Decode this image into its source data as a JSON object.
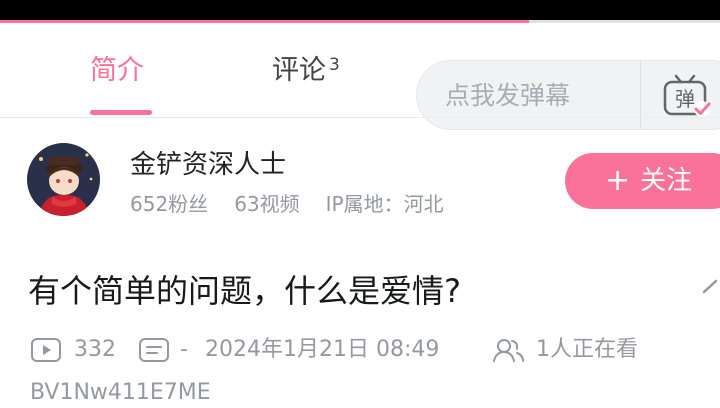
{
  "progress": {
    "fraction": 0.735
  },
  "tabs": {
    "intro_label": "简介",
    "comments_label": "评论",
    "comments_count": "3"
  },
  "danmaku": {
    "placeholder": "点我发弹幕",
    "toggle_label": "弹"
  },
  "uploader": {
    "name": "金铲资深人士",
    "followers": "652粉丝",
    "videos": "63视频",
    "ip_location": "IP属地：河北"
  },
  "follow_button": {
    "plus": "+",
    "label": "关注"
  },
  "video": {
    "title": "有个简单的问题，什么是爱情?",
    "plays": "332",
    "danmaku_count": "-",
    "date": "2024年1月21日 08:49",
    "watching": "1人正在看",
    "bvid": "BV1Nw411E7ME"
  },
  "colors": {
    "accent": "#fb7299",
    "secondary_text": "#9499a0"
  }
}
